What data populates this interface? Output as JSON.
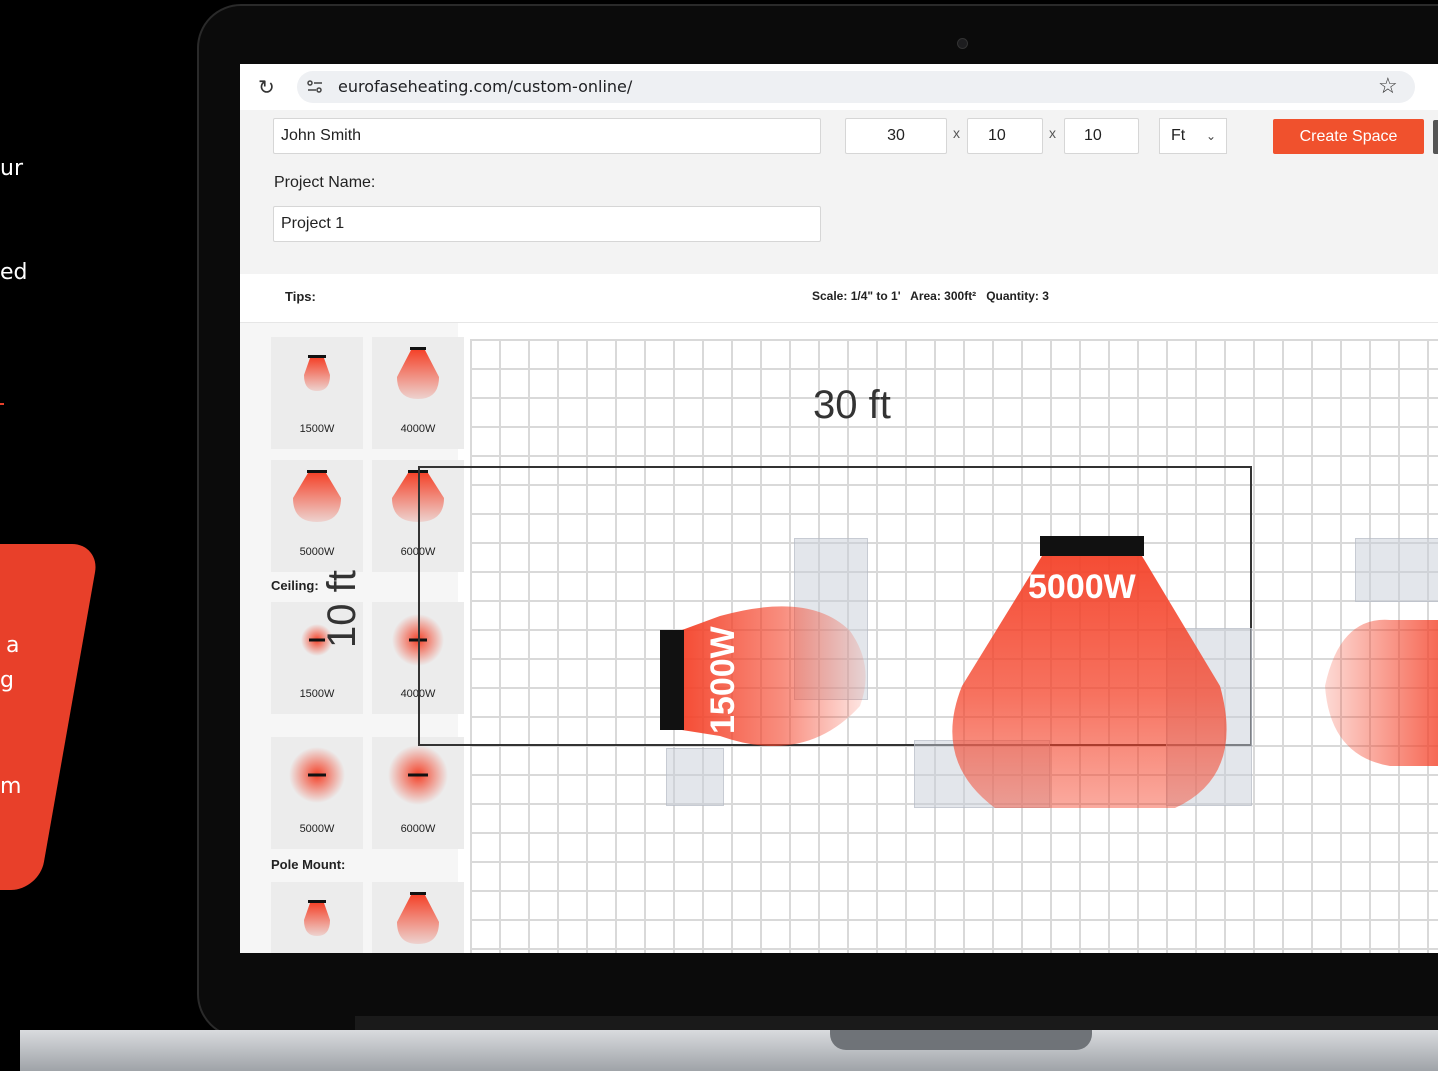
{
  "side_text": {
    "line1": "ur",
    "line2": "ed",
    "card_line1": "a",
    "card_line2": "g",
    "card_line3": "m"
  },
  "browser": {
    "url": "eurofaseheating.com/custom-online/"
  },
  "form": {
    "name_value": "John Smith",
    "dim_length": "30",
    "dim_width": "10",
    "dim_height": "10",
    "separator": "x",
    "unit_selected": "Ft",
    "create_button": "Create Space",
    "project_name_label": "Project Name:",
    "project_name_value": "Project 1"
  },
  "info_bar": {
    "tips_label": "Tips:",
    "scale": "Scale: 1/4\" to 1'",
    "area": "Area: 300ft²",
    "quantity": "Quantity: 3"
  },
  "palette": {
    "wall_items": [
      {
        "label": "1500W"
      },
      {
        "label": "4000W"
      },
      {
        "label": "5000W"
      },
      {
        "label": "6000W"
      }
    ],
    "ceiling_label": "Ceiling:",
    "ceiling_items": [
      {
        "label": "1500W"
      },
      {
        "label": "4000W"
      },
      {
        "label": "5000W"
      },
      {
        "label": "6000W"
      }
    ],
    "pole_mount_label": "Pole Mount:"
  },
  "canvas": {
    "length_label": "30 ft",
    "width_label": "10 ft",
    "heater_left_label": "1500W",
    "heater_center_label": "5000W"
  },
  "colors": {
    "accent": "#f0512d",
    "heat": "#f4432a"
  }
}
